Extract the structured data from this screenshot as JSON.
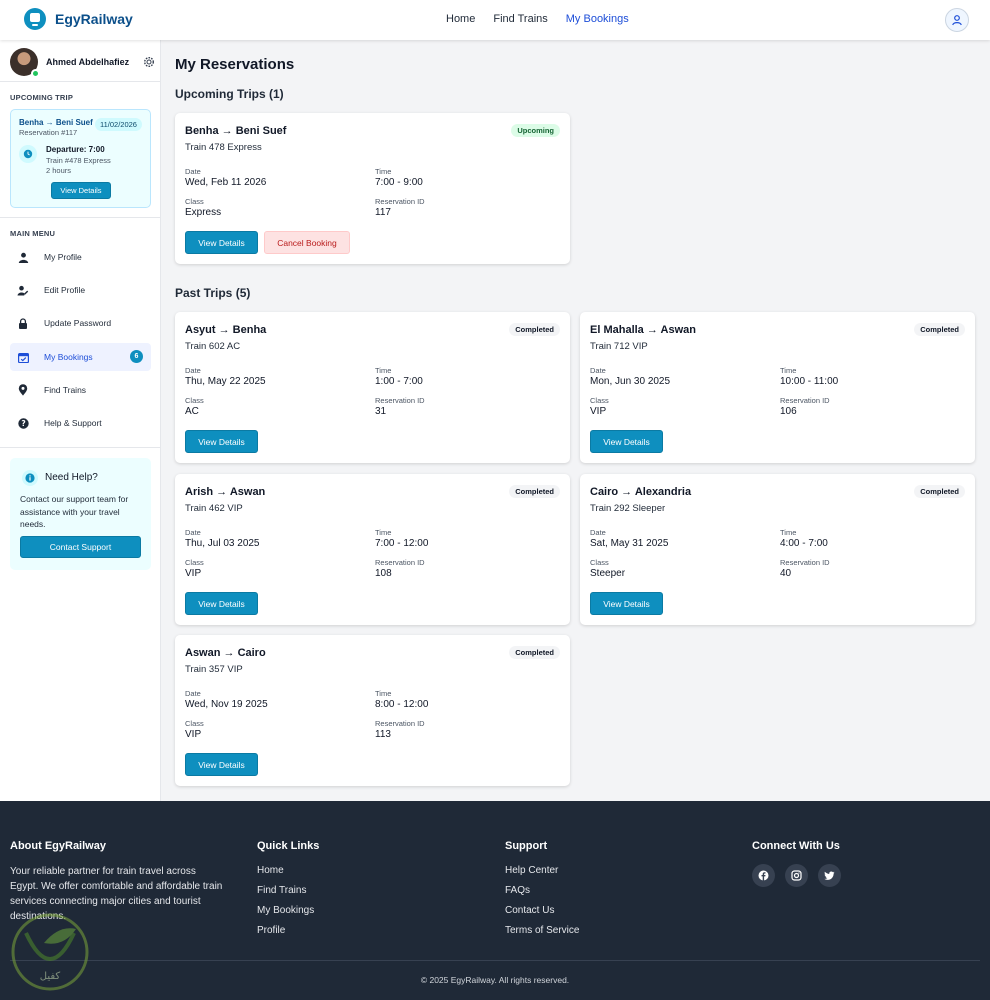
{
  "app": {
    "brand": "EgyRailway"
  },
  "nav": {
    "links": [
      "Home",
      "Find Trains",
      "My Bookings"
    ],
    "active": "My Bookings"
  },
  "sidebar": {
    "user_name": "Ahmed Abdelhafiez",
    "upcoming_heading": "UPCOMING TRIP",
    "upcoming": {
      "route": "Benha → Beni Suef",
      "reservation": "Reservation #117",
      "date": "11/02/2026",
      "departure": "Departure: 7:00",
      "train": "Train #478 Express",
      "duration": "2 hours",
      "button": "View Details"
    },
    "menu_heading": "MAIN MENU",
    "menu": [
      {
        "label": "My Profile",
        "icon": "user-icon"
      },
      {
        "label": "Edit Profile",
        "icon": "user-edit-icon"
      },
      {
        "label": "Update Password",
        "icon": "lock-icon"
      },
      {
        "label": "My Bookings",
        "icon": "calendar-check-icon",
        "badge": "6",
        "active": true
      },
      {
        "label": "Find Trains",
        "icon": "map-pin-icon"
      },
      {
        "label": "Help & Support",
        "icon": "question-circle-icon"
      }
    ],
    "help": {
      "title": "Need Help?",
      "text": "Contact our support team for assistance with your travel needs.",
      "button": "Contact Support"
    }
  },
  "main": {
    "title": "My Reservations",
    "upcoming_title": "Upcoming Trips (1)",
    "past_title": "Past Trips (5)",
    "labels": {
      "date": "Date",
      "time": "Time",
      "class": "Class",
      "reservation_id": "Reservation ID"
    },
    "view_details": "View Details",
    "cancel_booking": "Cancel Booking",
    "upcoming": [
      {
        "route": "Benha → Beni Suef",
        "train": "Train 478 Express",
        "status": "Upcoming",
        "date": "Wed, Feb 11 2026",
        "time": "7:00 - 9:00",
        "class": "Express",
        "reservation_id": "117"
      }
    ],
    "past": [
      {
        "route": "Asyut → Benha",
        "train": "Train 602 AC",
        "status": "Completed",
        "date": "Thu, May 22 2025",
        "time": "1:00 - 7:00",
        "class": "AC",
        "reservation_id": "31"
      },
      {
        "route": "El Mahalla → Aswan",
        "train": "Train 712 VIP",
        "status": "Completed",
        "date": "Mon, Jun 30 2025",
        "time": "10:00 - 11:00",
        "class": "VIP",
        "reservation_id": "106"
      },
      {
        "route": "Arish → Aswan",
        "train": "Train 462 VIP",
        "status": "Completed",
        "date": "Thu, Jul 03 2025",
        "time": "7:00 - 12:00",
        "class": "VIP",
        "reservation_id": "108"
      },
      {
        "route": "Cairo → Alexandria",
        "train": "Train 292 Sleeper",
        "status": "Completed",
        "date": "Sat, May 31 2025",
        "time": "4:00 - 7:00",
        "class": "Steeper",
        "reservation_id": "40"
      },
      {
        "route": "Aswan → Cairo",
        "train": "Train 357 VIP",
        "status": "Completed",
        "date": "Wed, Nov 19 2025",
        "time": "8:00 - 12:00",
        "class": "VIP",
        "reservation_id": "113"
      }
    ]
  },
  "footer": {
    "about_title": "About EgyRailway",
    "about_text": "Your reliable partner for train travel across Egypt. We offer comfortable and affordable train services connecting major cities and tourist destinations.",
    "quick_title": "Quick Links",
    "quick_links": [
      "Home",
      "Find Trains",
      "My Bookings",
      "Profile"
    ],
    "support_title": "Support",
    "support_links": [
      "Help Center",
      "FAQs",
      "Contact Us",
      "Terms of Service"
    ],
    "connect_title": "Connect With Us",
    "socials": [
      "facebook-icon",
      "instagram-icon",
      "twitter-icon"
    ],
    "copyright": "© 2025 EgyRailway. All rights reserved.",
    "watermark_text": "كفيل"
  },
  "colors": {
    "primary": "#0e8fbf",
    "brand": "#0b4f8a",
    "footer": "#1f2937",
    "active_link": "#1d4ed8"
  }
}
